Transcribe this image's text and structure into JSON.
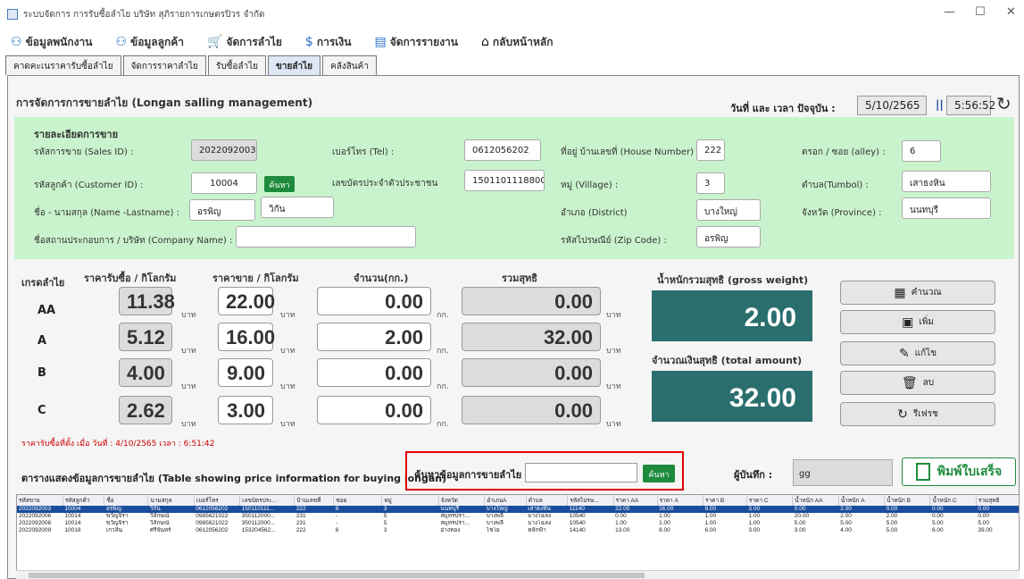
{
  "window": {
    "title": "ระบบจัดการ การรับซื้อลำไย บริษัท สุภิรายการเกษตรปิวร จำกัด",
    "minimize": "—",
    "maximize": "☐",
    "close": "✕"
  },
  "menu": [
    {
      "icon": "users-icon",
      "glyph": "⚇",
      "label": "ข้อมูลพนักงาน"
    },
    {
      "icon": "customers-icon",
      "glyph": "⚇",
      "label": "ข้อมูลลูกค้า"
    },
    {
      "icon": "cart-icon",
      "glyph": "🛒",
      "label": "จัดการลำไย"
    },
    {
      "icon": "dollar-icon",
      "glyph": "$",
      "label": "การเงิน"
    },
    {
      "icon": "report-icon",
      "glyph": "▤",
      "label": "จัดการรายงาน"
    },
    {
      "icon": "home-icon",
      "glyph": "⌂",
      "label": "กลับหน้าหลัก"
    }
  ],
  "tabs": [
    "คาดคะเนราคารับซื้อลำไย",
    "จัดการราคาลำไย",
    "รับซื้อลำไย",
    "ขายลำไย",
    "คลังสินค้า"
  ],
  "page": {
    "title": "การจัดการการขายลำไย (Longan salling management)",
    "datetime_label": "วันที่ และ เวลา ปัจจุบัน :",
    "date": "5/10/2565",
    "separator": "||",
    "time": "5:56:52"
  },
  "sale": {
    "section_title": "รายละเอียดการขาย",
    "sales_id_label": "รหัสการขาย (Sales ID) :",
    "sales_id": "2022092003",
    "customer_id_label": "รหัสลูกค้า (Customer ID) :",
    "customer_id": "10004",
    "search_label": "ค้นหา",
    "name_label": "ชื่อ - นามสกุล (Name -Lastname) :",
    "first_name": "อรพิญ",
    "last_name": "วิกัน",
    "company_label": "ชื่อสถานประกอบการ / บริษัท (Company Name) :",
    "company": "",
    "tel_label": "เบอร์โทร (Tel) :",
    "tel": "0612056202",
    "idcard_label": "เลขบัตรประจำตัวประชาชน",
    "idcard": "1501101118800",
    "house_label": "ที่อยู่ บ้านเลขที่ (House Number) :",
    "house": "222",
    "village_label": "หมู่ (Village) :",
    "village": "3",
    "district_label": "อำเภอ (District)",
    "district": "บางใหญ่",
    "zip_label": "รหัสไปรษณีย์ (Zip Code) :",
    "zip": "อรพิญ",
    "alley_label": "ตรอก / ซอย (alley) :",
    "alley": "6",
    "tumbol_label": "ตำบล(Tumbol) :",
    "tumbol": "เสาธงหิน",
    "province_label": "จังหวัด (Province) :",
    "province": "นนทบุรี"
  },
  "pricing": {
    "head_grade": "เกรดลำไย",
    "head_buy": "ราคารับซื้อ / กิโลกรัม",
    "head_sell": "ราคาขาย / กิโลกรัม",
    "head_qty": "จำนวน(กก.)",
    "head_total": "รวมสุทธิ",
    "unit_baht": "บาท",
    "unit_kg": "กก.",
    "rows": [
      {
        "grade": "AA",
        "buy": "11.38",
        "sell": "22.00",
        "qty": "0.00",
        "total": "0.00"
      },
      {
        "grade": "A",
        "buy": "5.12",
        "sell": "16.00",
        "qty": "2.00",
        "total": "32.00"
      },
      {
        "grade": "B",
        "buy": "4.00",
        "sell": "9.00",
        "qty": "0.00",
        "total": "0.00"
      },
      {
        "grade": "C",
        "buy": "2.62",
        "sell": "3.00",
        "qty": "0.00",
        "total": "0.00"
      }
    ],
    "gross_label": "น้ำหนักรวมสุทธิ (gross weight)",
    "gross": "2.00",
    "amount_label": "จำนวณเงินสุทธิ (total amount)",
    "amount": "32.00",
    "note": "ราคารับซื้อที่ตั้ง เมื่อ วันที่ : 4/10/2565 เวลา : 6:51:42"
  },
  "actions": [
    {
      "name": "calculate-button",
      "icon": "calculator-icon",
      "glyph": "▦",
      "label": "คำนวณ"
    },
    {
      "name": "add-button",
      "icon": "save-icon",
      "glyph": "▣",
      "label": "เพิ่ม"
    },
    {
      "name": "edit-button",
      "icon": "edit-icon",
      "glyph": "✎",
      "label": "แก้ไข"
    },
    {
      "name": "delete-button",
      "icon": "trash-icon",
      "glyph": "🗑",
      "label": "ลบ"
    },
    {
      "name": "refresh-button",
      "icon": "refresh-icon",
      "glyph": "↻",
      "label": "รีเฟรช"
    }
  ],
  "table": {
    "title": "ตารางแสดงข้อมูลการขายลำไย (Table showing price information for buying longan)",
    "search_label": "ค้นหาข้อมูลการขายลำไย :",
    "search_value": "",
    "search_button": "ค้นหา",
    "recorder_label": "ผู้บันทึก :",
    "recorder": "gg",
    "print_label": "พิมพ์ใบเสร็จ",
    "columns": [
      "รหัสขาย",
      "รหัสลูกค้า",
      "ชื่อ",
      "นามสกุล",
      "เบอร์โทร",
      "เลขบัตรประ...",
      "บ้านเลขที่",
      "ซอย",
      "หมู่",
      "จังหวัด",
      "อำเภอA",
      "ตำบล",
      "รหัสไปรษ...",
      "ราคา AA",
      "ราคา A",
      "ราคา B",
      "ราคา C",
      "น้ำหนัก AA",
      "น้ำหนัก A",
      "น้ำหนัก B",
      "น้ำหนัก C",
      "รวมสุทธิ"
    ],
    "rows": [
      [
        "2022092003",
        "10004",
        "อรพิญ",
        "วิกัน",
        "0612056202",
        "150110111...",
        "222",
        "6",
        "3",
        "นนทบุรี",
        "บางใหญ่",
        "เสาธงหิน",
        "11140",
        "22.00",
        "16.00",
        "9.00",
        "3.00",
        "0.00",
        "2.00",
        "0.00",
        "0.00",
        "0.00"
      ],
      [
        "2022092006",
        "10014",
        "ขวัญจิรา",
        "วิลักษณ์",
        "0985621022",
        "350112000...",
        "231",
        "-",
        "5",
        "สมุทรปรา...",
        "บางพลี",
        "บางโฉลง",
        "10540",
        "0.00",
        "1.00",
        "1.00",
        "1.00",
        "20.00",
        "2.00",
        "2.00",
        "0.00",
        "0.00"
      ],
      [
        "2022092008",
        "10014",
        "ขวัญจิรา",
        "วิลักษณ์",
        "0985621022",
        "350112000...",
        "231",
        "-",
        "5",
        "สมุทรปรา...",
        "บางพลี",
        "บางโฉลง",
        "10540",
        "1.00",
        "1.00",
        "1.00",
        "1.00",
        "5.00",
        "5.00",
        "5.00",
        "5.00",
        "5.00"
      ],
      [
        "2022092009",
        "10018",
        "เกวลิน",
        "ศรีจันทร์",
        "0612056202",
        "153204562...",
        "222",
        "6",
        "3",
        "อ่างทอง",
        "ไชโย",
        "หลักฟ้า",
        "14140",
        "13.00",
        "8.00",
        "6.00",
        "3.00",
        "3.00",
        "4.00",
        "5.00",
        "6.00",
        "39.00"
      ]
    ]
  }
}
